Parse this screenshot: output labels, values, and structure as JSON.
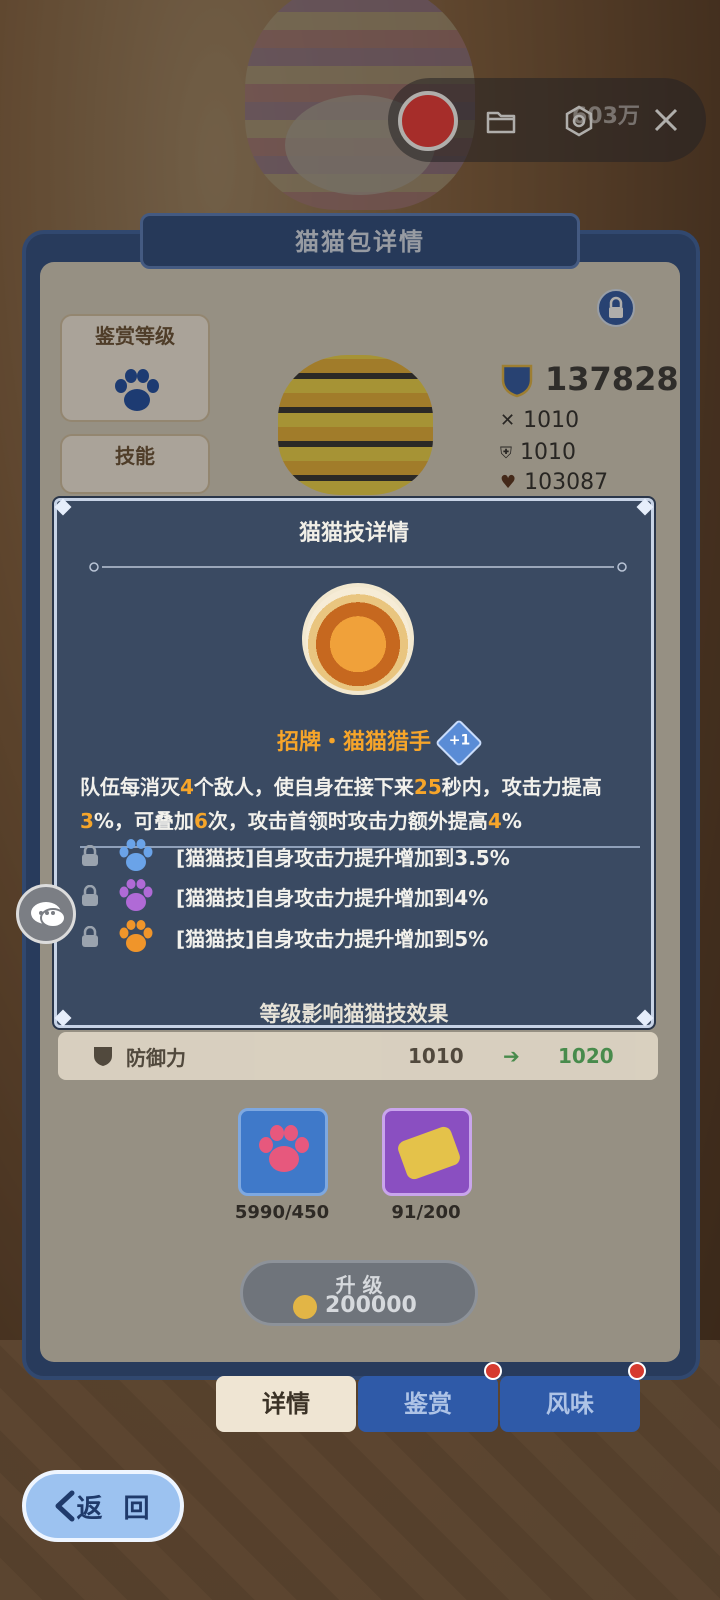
{
  "recorder": {
    "coins_label": "603万"
  },
  "panel": {
    "title": "猫猫包详情",
    "appraisal_label": "鉴赏等级",
    "skill_label": "技能",
    "power": "137828",
    "attack": "1010",
    "defense": "1010",
    "hp": "103087"
  },
  "modal": {
    "title": "猫猫技详情",
    "skill_name": "招牌・猫猫猎手",
    "plus_badge": "+1",
    "description": [
      {
        "t": "队伍每消灭"
      },
      {
        "t": "4",
        "hl": true
      },
      {
        "t": "个敌人，使自身在接下来"
      },
      {
        "t": "25",
        "hl": true
      },
      {
        "t": "秒内，攻击力"
      },
      {
        "t": "提高"
      },
      {
        "t": "3",
        "hl": true
      },
      {
        "t": "%，可叠加"
      },
      {
        "t": "6",
        "hl": true
      },
      {
        "t": "次，攻击首领时攻击力额外提高"
      },
      {
        "t": "4",
        "hl": true
      },
      {
        "t": "%"
      }
    ],
    "upgrades": [
      {
        "text": "[猫猫技]自身攻击力提升增加到3.5%",
        "paw_color": "#6aa3e8"
      },
      {
        "text": "[猫猫技]自身攻击力提升增加到4%",
        "paw_color": "#b06ad6"
      },
      {
        "text": "[猫猫技]自身攻击力提升增加到5%",
        "paw_color": "#f0952a"
      }
    ],
    "footer": "等级影响猫猫技效果"
  },
  "defense_row": {
    "label": "防御力",
    "current": "1010",
    "next": "1020"
  },
  "materials": [
    {
      "count": "5990/450"
    },
    {
      "count": "91/200"
    }
  ],
  "upgrade_button": {
    "label": "升 级",
    "cost": "200000"
  },
  "tabs": [
    {
      "label": "详情"
    },
    {
      "label": "鉴赏"
    },
    {
      "label": "风味"
    }
  ],
  "back_button": {
    "label": "返 回"
  },
  "colors": {
    "modal_bg": "#3a4a62",
    "highlight": "#f6a52a",
    "panel_blue": "#2e4f86",
    "next_value_green": "#2f8a3a"
  }
}
